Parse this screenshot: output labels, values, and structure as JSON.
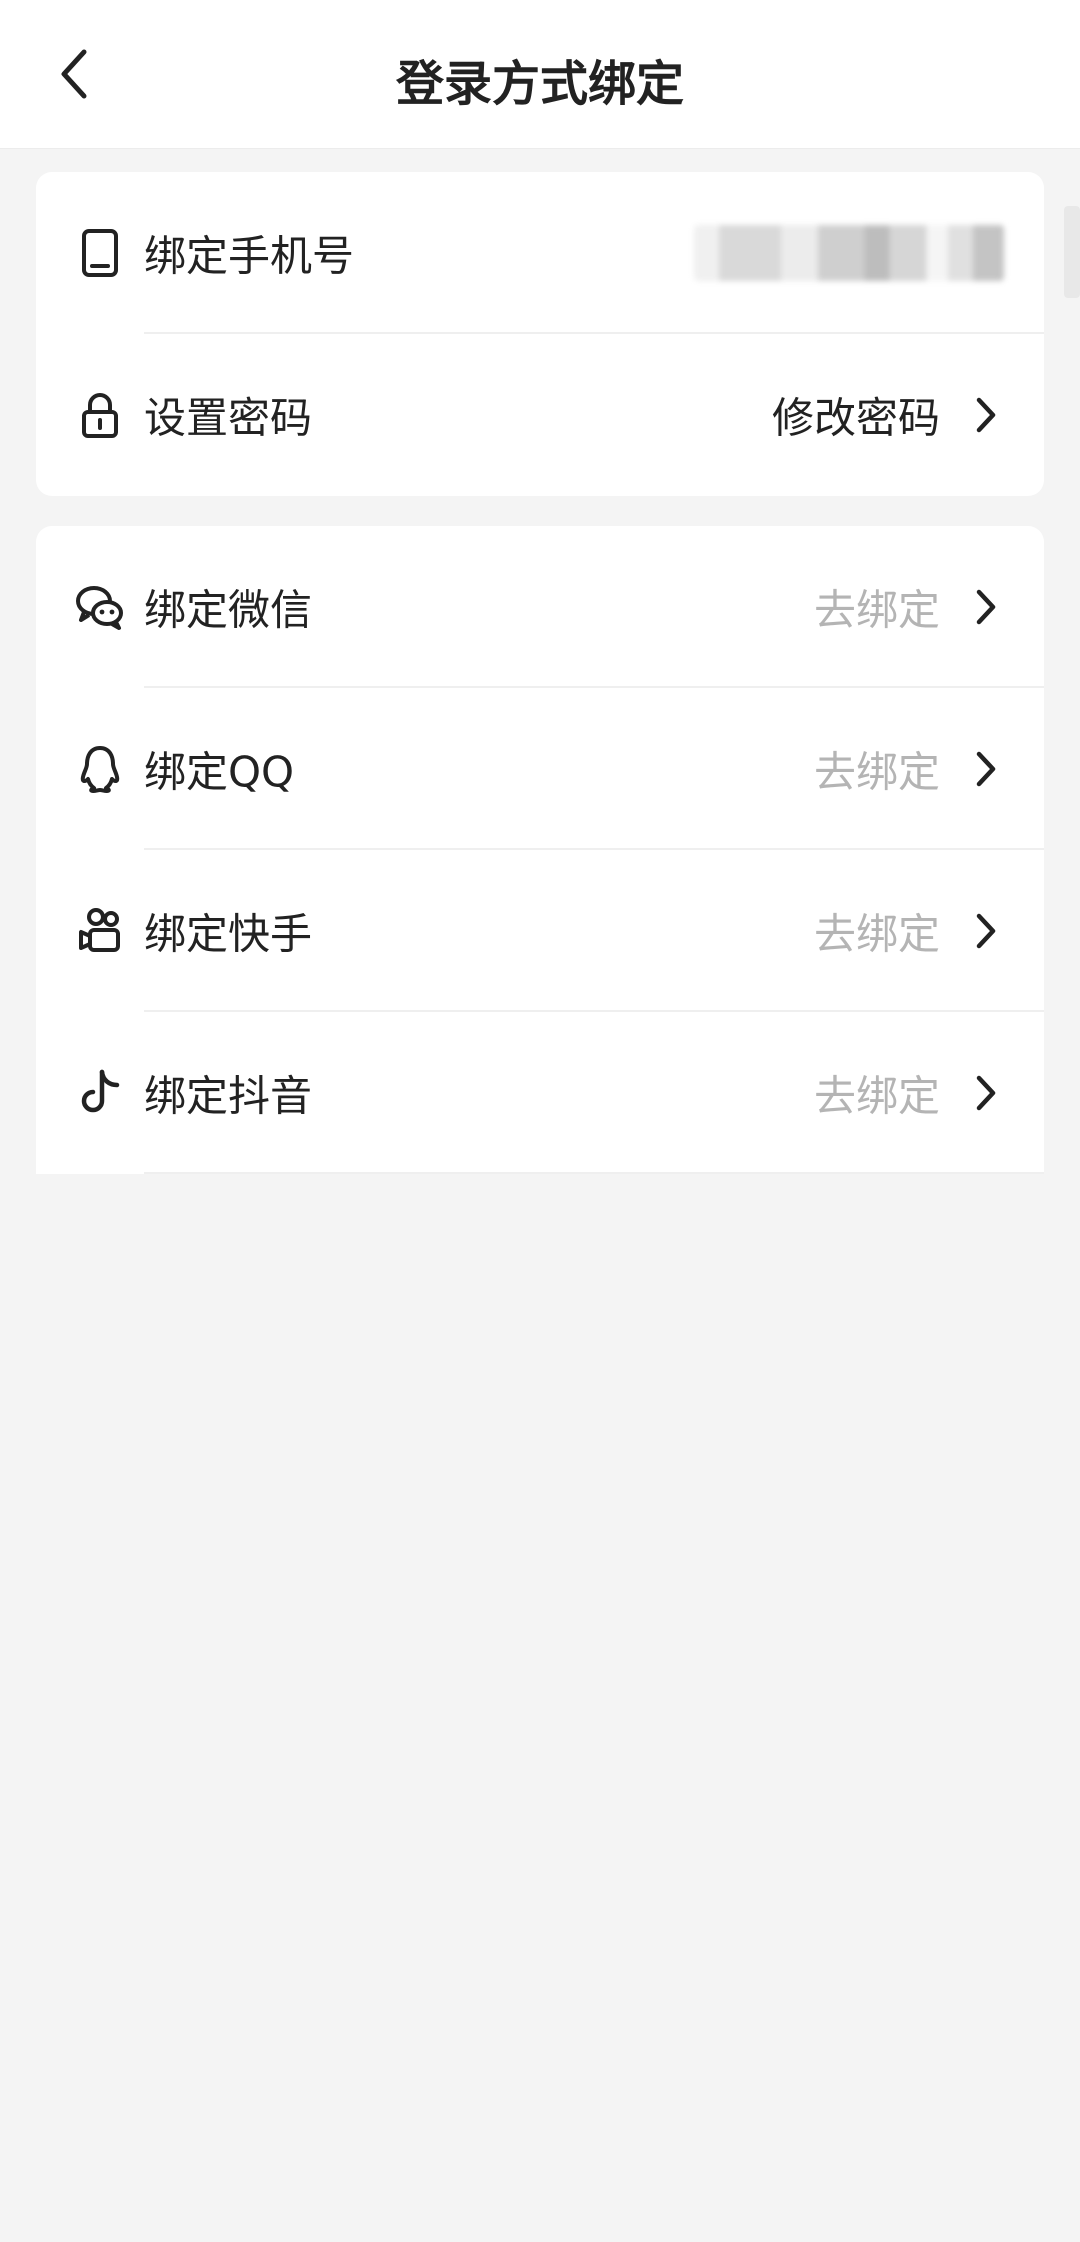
{
  "header": {
    "title": "登录方式绑定"
  },
  "account_section": {
    "phone": {
      "label": "绑定手机号"
    },
    "password": {
      "label": "设置密码",
      "action": "修改密码"
    }
  },
  "bind_section": {
    "items": [
      {
        "label": "绑定微信",
        "action": "去绑定",
        "icon": "wechat-icon"
      },
      {
        "label": "绑定QQ",
        "action": "去绑定",
        "icon": "qq-icon"
      },
      {
        "label": "绑定快手",
        "action": "去绑定",
        "icon": "kuaishou-icon"
      },
      {
        "label": "绑定抖音",
        "action": "去绑定",
        "icon": "douyin-icon"
      }
    ]
  },
  "colors": {
    "muted_text": "#b4b4b4",
    "page_bg": "#f4f4f4"
  }
}
